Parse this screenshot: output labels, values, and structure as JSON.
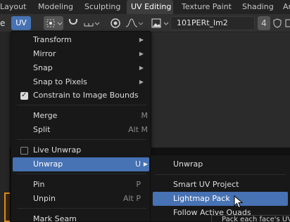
{
  "workspace_tabs": [
    "Layout",
    "Modeling",
    "Sculpting",
    "UV Editing",
    "Texture Paint",
    "Shading",
    "An"
  ],
  "active_tab": "UV Editing",
  "header": {
    "view_menu": "e",
    "uv_menu": "UV",
    "image_name": "101PERt_lm2",
    "user_count": "4"
  },
  "uv_menu": {
    "items": [
      {
        "label": "Transform",
        "submenu": true
      },
      {
        "label": "Mirror",
        "submenu": true
      },
      {
        "label": "Snap",
        "submenu": true
      },
      {
        "label": "Snap to Pixels",
        "submenu": true
      },
      {
        "label": "Constrain to Image Bounds",
        "checked": true
      },
      {
        "label": "Merge",
        "shortcut": "M"
      },
      {
        "label": "Split",
        "shortcut": "Alt M"
      },
      {
        "label": "Live Unwrap",
        "checked": false
      },
      {
        "label": "Unwrap",
        "shortcut": "U"
      },
      {
        "label": "Pin",
        "shortcut": "P"
      },
      {
        "label": "Unpin",
        "shortcut": "Alt P"
      },
      {
        "label": "Mark Seam"
      }
    ]
  },
  "unwrap_submenu": {
    "items": [
      "Unwrap",
      "Smart UV Project",
      "Lightmap Pack",
      "Follow Active Quads"
    ]
  },
  "tooltip": "Pack each face's UV",
  "colors": {
    "accent": "#4772b3",
    "menu_bg": "#181818",
    "header_bg": "#303030",
    "object_outline": "#e08a18"
  }
}
